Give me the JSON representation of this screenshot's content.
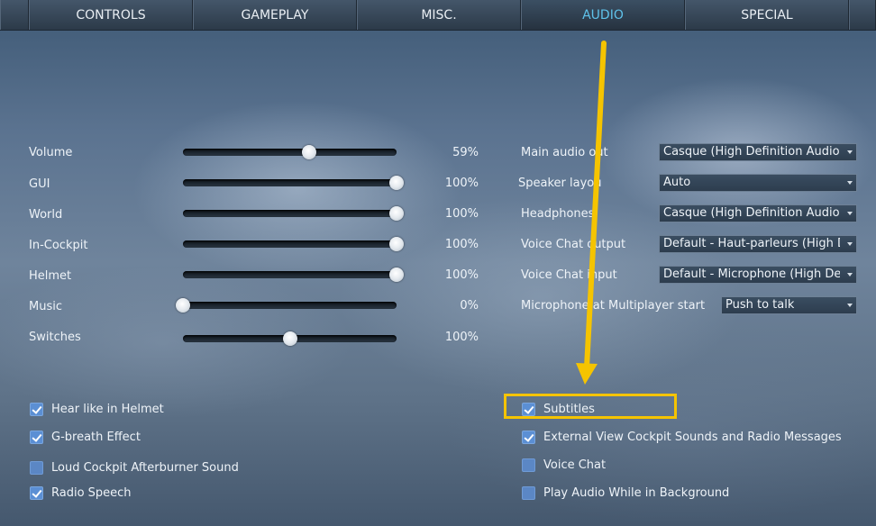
{
  "tabs": [
    {
      "label": "CONTROLS",
      "active": false
    },
    {
      "label": "GAMEPLAY",
      "active": false
    },
    {
      "label": "MISC.",
      "active": false
    },
    {
      "label": "AUDIO",
      "active": true
    },
    {
      "label": "SPECIAL",
      "active": false
    }
  ],
  "sliders": [
    {
      "label": "Volume",
      "value_text": "59%",
      "level": 0.59
    },
    {
      "label": "GUI",
      "value_text": "100%",
      "level": 1.0
    },
    {
      "label": "World",
      "value_text": "100%",
      "level": 1.0
    },
    {
      "label": "In-Cockpit",
      "value_text": "100%",
      "level": 1.0
    },
    {
      "label": "Helmet",
      "value_text": "100%",
      "level": 1.0
    },
    {
      "label": "Music",
      "value_text": "0%",
      "level": 0.0
    },
    {
      "label": "Switches",
      "value_text": "100%",
      "level": 0.5
    }
  ],
  "dropdowns": [
    {
      "label": "Main audio out",
      "value": "Casque (High Definition Audio Dev"
    },
    {
      "label": "Speaker layou",
      "value": "Auto"
    },
    {
      "label": "Headphones",
      "value": "Casque (High Definition Audio Dev"
    },
    {
      "label": "Voice Chat output",
      "value": "Default - Haut-parleurs (High Defir"
    },
    {
      "label": "Voice Chat input",
      "value": "Default - Microphone (High Definit"
    },
    {
      "label": "Microphone at Multiplayer start",
      "value": "Push to talk"
    }
  ],
  "checkboxes_left": [
    {
      "label": "Hear like in Helmet",
      "checked": true
    },
    {
      "label": "G-breath Effect",
      "checked": true
    },
    {
      "label": "Loud Cockpit Afterburner Sound",
      "checked": false
    },
    {
      "label": "Radio Speech",
      "checked": true
    }
  ],
  "checkboxes_right": [
    {
      "label": "Subtitles",
      "checked": true
    },
    {
      "label": "External View Cockpit Sounds and Radio Messages",
      "checked": true
    },
    {
      "label": "Voice Chat",
      "checked": false
    },
    {
      "label": "Play Audio While in Background",
      "checked": false
    }
  ],
  "colors": {
    "accent_tab": "#5fc2ea",
    "checkbox": "#5b8fd4",
    "annotation": "#f5c400"
  }
}
